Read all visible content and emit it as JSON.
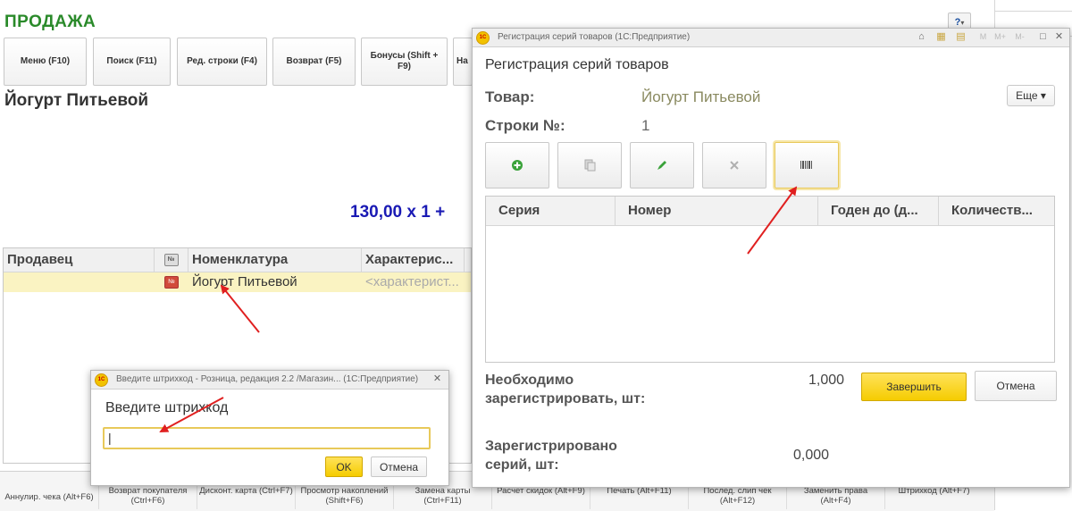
{
  "sale": {
    "title": "ПРОДАЖА",
    "top_buttons": [
      "Меню (F10)",
      "Поиск (F11)",
      "Ред. строки (F4)",
      "Возврат (F5)",
      "Бонусы (Shift + F9)",
      "На"
    ],
    "product_name": "Йогурт Питьевой",
    "sum_line": "130,00  x 1  +",
    "help_label": "?",
    "table": {
      "headers": [
        "Продавец",
        "№",
        "Номенклатура",
        "Характерис..."
      ],
      "row": {
        "seller": "",
        "icon": "№",
        "item": "Йогурт Питьевой",
        "characteristic": "<характерист..."
      }
    },
    "bottom_buttons": [
      "Аннулир. чека (Alt+F6)",
      "Возврат покупателя (Ctrl+F6)",
      "Дисконт. карта (Ctrl+F7)",
      "Просмотр накоплений (Shift+F6)",
      "Замена карты (Ctrl+F11)",
      "Расчет скидок (Alt+F9)",
      "Печать (Alt+F11)",
      "Послед. слип чек (Alt+F12)",
      "Заменить права (Alt+F4)",
      "Штрихкод (Alt+F7)"
    ]
  },
  "series_window": {
    "bar_title": "Регистрация серий товаров  (1С:Предприятие)",
    "bar_controls": [
      "M",
      "M+",
      "M-",
      "□",
      "✕"
    ],
    "heading": "Регистрация серий товаров",
    "product_label": "Товар:",
    "product_value": "Йогурт Питьевой",
    "row_label": "Строки №:",
    "row_value": "1",
    "more_label": "Еще ▾",
    "grid_headers": [
      "Серия",
      "Номер",
      "Годен до (д...",
      "Количеств..."
    ],
    "need_label": "Необходимо зарегистрировать, шт:",
    "need_value": "1,000",
    "registered_label": "Зарегистрировано серий, шт:",
    "registered_value": "0,000",
    "finish_label": "Завершить",
    "cancel_label": "Отмена"
  },
  "barcode_dialog": {
    "bar_title": "Введите штрихкод - Розница, редакция 2.2 /Магазин...  (1С:Предприятие)",
    "prompt": "Введите штрихкод",
    "input_value": "|",
    "ok_label": "OK",
    "cancel_label": "Отмена"
  },
  "colors": {
    "accent_yellow": "#f5cc00",
    "sale_title_green": "#2a8a2a",
    "sum_blue": "#1a1ab4",
    "arrow_red": "#e02020"
  },
  "icons": [
    "add-icon",
    "copy-icon",
    "edit-icon",
    "delete-icon",
    "barcode-icon",
    "logo-1c-icon",
    "help-icon",
    "close-icon"
  ]
}
